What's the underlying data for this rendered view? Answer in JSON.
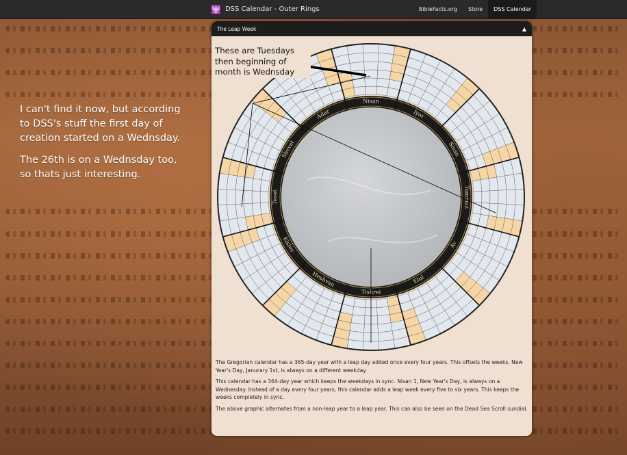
{
  "window": {
    "title": "DSS Calendar - Outer Rings"
  },
  "nav": {
    "items": [
      "BibleFacts.org",
      "Store",
      "DSS Calendar"
    ],
    "active": "DSS Calendar"
  },
  "panel": {
    "title": "The Leap Week",
    "collapse_glyph": "▲"
  },
  "annotation": "These are Tuesdays then beginning of month is Wednsday",
  "left_note": {
    "p1": "I can't find it now, but according to DSS's stuff the first day of creation started on a Wednsday.",
    "p2": "The 26th is on a Wednsday too, so thats just interesting."
  },
  "months": [
    "Nisan",
    "Iyar",
    "Sivan",
    "Tammuz",
    "Av",
    "Elul",
    "Tishrei",
    "Heshvan",
    "Kislev",
    "Tevet",
    "Shevat",
    "Adar"
  ],
  "description": [
    "The Gregorian calendar has a 365-day year with a leap day added once every four years. This offsets the weeks. New Year's Day, Janurary 1st, is always on a different weekday.",
    "This calendar has a 364-day year which keeps the weekdays in sync. Nisan 1, New Year's Day, is always on a Wednesday. Instead of a day every four years, this calendar adds a leap week every five to six years. This keeps the weeks completely in sync.",
    "The above graphic alternates from a non-leap year to a leap year. This can also be seen on the Dead Sea Scroll sundial."
  ],
  "colors": {
    "highlight": "#f6d6a6",
    "cell": "#e3e8ee",
    "ring": "#1a1a1a",
    "center": "#c5c8cb"
  }
}
